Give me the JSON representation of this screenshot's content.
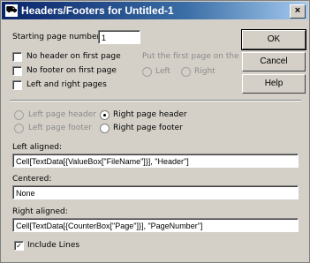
{
  "window": {
    "title": "Headers/Footers for Untitled-1",
    "close_glyph": "×",
    "app_icon_glyph": "⛟"
  },
  "starting_page": {
    "label": "Starting page number:",
    "value": "1"
  },
  "checkboxes": {
    "no_header_first": {
      "label": "No header on first page",
      "checked": false
    },
    "no_footer_first": {
      "label": "No footer on first page",
      "checked": false
    },
    "left_right_pages": {
      "label": "Left and right pages",
      "checked": false
    }
  },
  "first_page": {
    "label": "Put the first page on the",
    "left": "Left",
    "right": "Right"
  },
  "buttons": {
    "ok": "OK",
    "cancel": "Cancel",
    "help": "Help"
  },
  "page_selectors": {
    "left_header": "Left page header",
    "right_header": "Right page header",
    "left_footer": "Left page footer",
    "right_footer": "Right page footer"
  },
  "left_aligned": {
    "label": "Left aligned:",
    "value": "Cell[TextData[{ValueBox[\"FileName\"]}], \"Header\"]"
  },
  "centered": {
    "label": "Centered:",
    "value": "None"
  },
  "right_aligned": {
    "label": "Right aligned:",
    "value": "Cell[TextData[{CounterBox[\"Page\"]}], \"PageNumber\"]"
  },
  "include_lines": {
    "label": "Include Lines",
    "checked": true,
    "check_glyph": "✓"
  }
}
